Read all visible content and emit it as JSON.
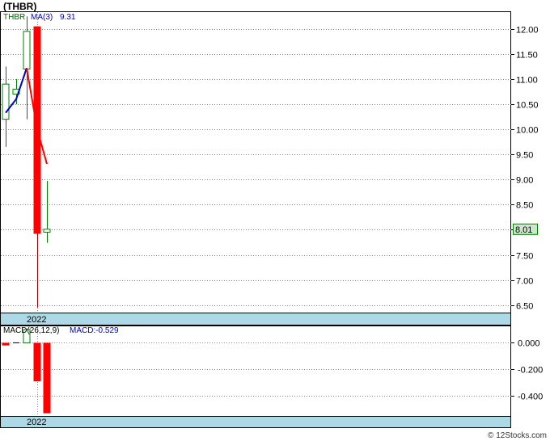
{
  "title": "(THBR)",
  "watermark": "© 12Stocks.com",
  "colors": {
    "up": "#008000",
    "down": "#ff0000",
    "ma_up": "#0000cc",
    "ma_down": "#ff0000",
    "grid": "#888888",
    "date_bar": "#add8e6",
    "last_price_bg": "#cce8cc"
  },
  "chart_data": [
    {
      "type": "candlestick",
      "ticker": "THBR",
      "legend": {
        "ticker_label": "THBR",
        "ma_label": "MA(3)",
        "ma_value": "9.31"
      },
      "candles": [
        {
          "open": 10.2,
          "high": 11.25,
          "low": 9.65,
          "close": 10.9
        },
        {
          "open": 10.7,
          "high": 11.0,
          "low": 10.5,
          "close": 10.8
        },
        {
          "open": 11.2,
          "high": 12.25,
          "low": 10.2,
          "close": 11.95
        },
        {
          "open": 12.05,
          "high": 12.05,
          "low": 6.45,
          "close": 7.92
        },
        {
          "open": 7.95,
          "high": 8.97,
          "low": 7.74,
          "close": 8.01
        }
      ],
      "ma3": [
        10.33,
        10.6,
        11.22,
        10.0,
        9.31
      ],
      "ylim": [
        6.35,
        12.35
      ],
      "yticks": [
        "12.00",
        "11.50",
        "11.00",
        "10.50",
        "10.00",
        "9.50",
        "9.00",
        "8.50",
        "8.00",
        "7.50",
        "7.00",
        "6.50"
      ],
      "last_price": "8.01",
      "date_label": "2022",
      "grid": true
    },
    {
      "type": "bar",
      "name": "MACD(26,12,9)",
      "legend": {
        "label": "MACD(26,12,9)",
        "value_label": "MACD:-0.529"
      },
      "histogram": [
        -0.02,
        0.0,
        0.1,
        -0.29,
        -0.53
      ],
      "ylim": [
        -0.55,
        0.13
      ],
      "yticks": [
        "0.000",
        "-0.200",
        "-0.400"
      ],
      "date_label": "2022",
      "grid": true
    }
  ]
}
